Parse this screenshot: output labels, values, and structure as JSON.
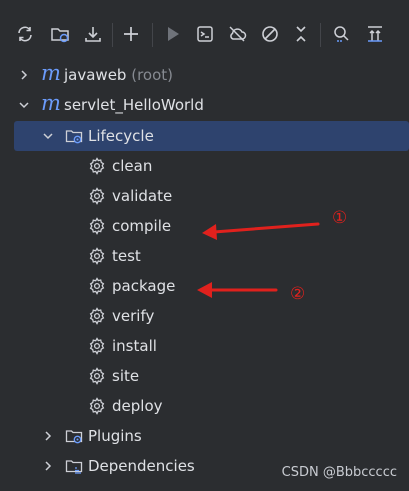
{
  "toolbar": {
    "buttons": [
      {
        "icon": "reload-icon"
      },
      {
        "icon": "generate-sources-icon"
      },
      {
        "icon": "download-icon"
      },
      {
        "icon": "add-icon"
      },
      {
        "icon": "run-icon"
      },
      {
        "icon": "run-configuration-icon"
      },
      {
        "icon": "offline-mode-icon"
      },
      {
        "icon": "skip-tests-icon"
      },
      {
        "icon": "collapse-icon"
      },
      {
        "icon": "show-dependencies-icon"
      },
      {
        "icon": "expand-all-icon"
      }
    ]
  },
  "tree": {
    "project_root": {
      "name": "javaweb",
      "suffix": "(root)"
    },
    "module": {
      "name": "servlet_HelloWorld"
    },
    "lifecycle": {
      "label": "Lifecycle",
      "phases": [
        "clean",
        "validate",
        "compile",
        "test",
        "package",
        "verify",
        "install",
        "site",
        "deploy"
      ]
    },
    "plugins": {
      "label": "Plugins"
    },
    "dependencies": {
      "label": "Dependencies"
    }
  },
  "annotations": {
    "marker_1": "①",
    "marker_2": "②"
  },
  "watermark": "CSDN @Bbbccccc",
  "colors": {
    "background": "#2b2d30",
    "selection": "#2e436e",
    "maven_logo": "#6b9bfa",
    "annotation": "#e0211d"
  }
}
